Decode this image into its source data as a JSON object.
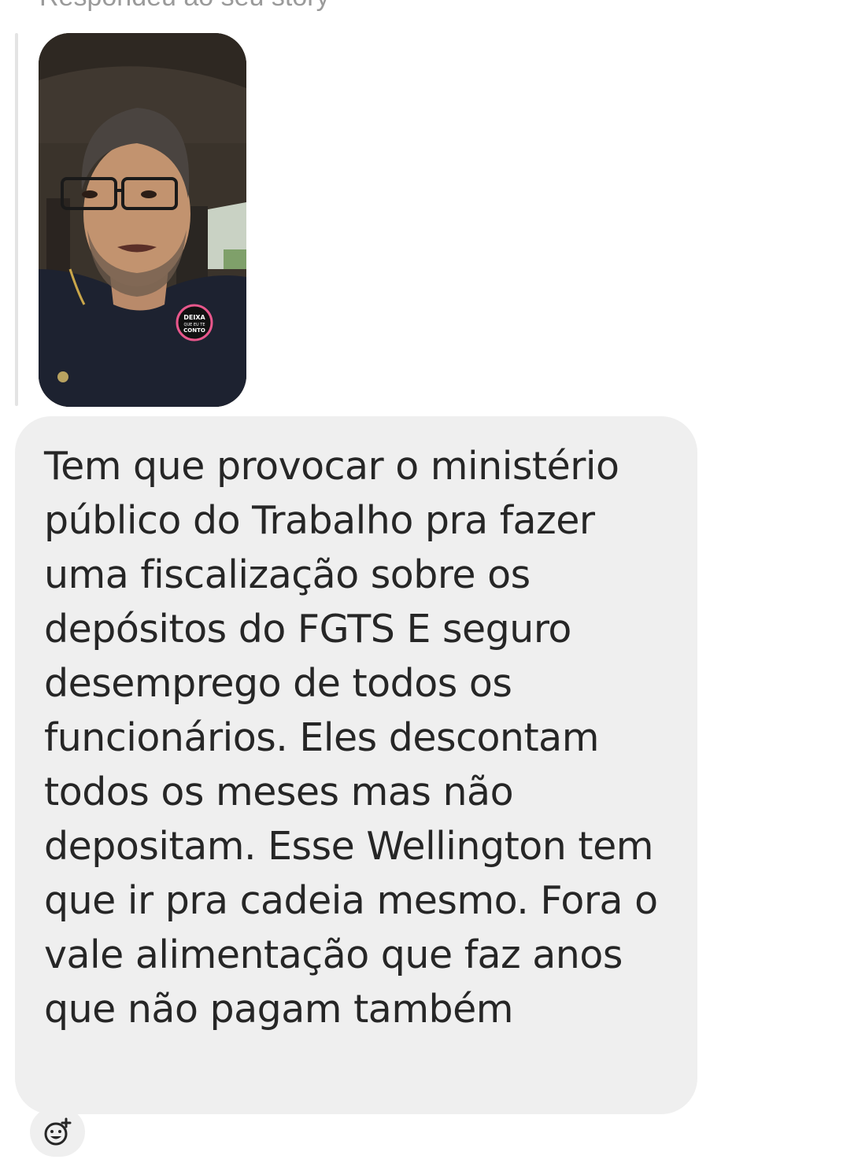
{
  "reply_context": {
    "label": "Respondeu ao seu story"
  },
  "story_preview": {
    "image_desc_icon": "story-thumbnail-man-in-car",
    "badge_text": "DEIXA QUE EU TE CONTO"
  },
  "message": {
    "text": "Tem que provocar o ministério público do Trabalho pra fazer uma fiscalização sobre os depósitos do FGTS E seguro desemprego de todos os funcionários. Eles descontam todos os meses mas não depositam. Esse Wellington tem que ir pra cadeia mesmo. Fora o vale alimentação que faz anos que não pagam também"
  },
  "reaction": {
    "icon": "add-reaction-icon"
  },
  "colors": {
    "bubble_bg": "#efefef",
    "text": "#262626",
    "muted": "#9a9a9a"
  }
}
